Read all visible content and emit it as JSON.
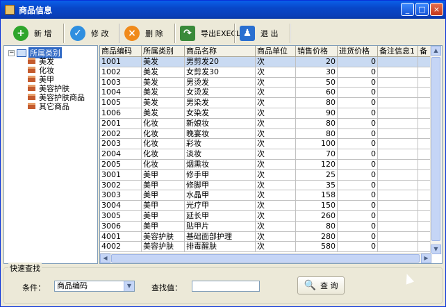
{
  "window": {
    "title": "商品信息",
    "min": "_",
    "max": "□",
    "close": "×"
  },
  "toolbar": [
    {
      "label": "新 增",
      "icon": "add-icon",
      "color": "#2fa52b",
      "glyph": "+"
    },
    {
      "label": "修 改",
      "icon": "edit-check-icon",
      "color": "#2f8fe0",
      "glyph": "✓"
    },
    {
      "label": "删 除",
      "icon": "delete-icon",
      "color": "#f08a1a",
      "glyph": "×"
    },
    {
      "label": "导出EXECL",
      "icon": "export-arrow-icon",
      "color": "#3a8a3a",
      "glyph": "↷"
    },
    {
      "label": "退 出",
      "icon": "exit-person-icon",
      "color": "#2a6fd0",
      "glyph": "♟"
    }
  ],
  "tree": {
    "root": "所属类别",
    "collapse": "−",
    "items": [
      "美发",
      "化妆",
      "美甲",
      "美容护肤",
      "美容护肤商品",
      "其它商品"
    ]
  },
  "table": {
    "columns": [
      "商品编码",
      "所属类别",
      "商品名称",
      "商品单位",
      "销售价格",
      "进货价格",
      "备注信息1",
      "备"
    ],
    "rows": [
      [
        "1001",
        "美发",
        "男剪发20",
        "次",
        "20",
        "0",
        "",
        ""
      ],
      [
        "1002",
        "美发",
        "女剪发30",
        "次",
        "30",
        "0",
        "",
        ""
      ],
      [
        "1003",
        "美发",
        "男烫发",
        "次",
        "50",
        "0",
        "",
        ""
      ],
      [
        "1004",
        "美发",
        "女烫发",
        "次",
        "60",
        "0",
        "",
        ""
      ],
      [
        "1005",
        "美发",
        "男染发",
        "次",
        "80",
        "0",
        "",
        ""
      ],
      [
        "1006",
        "美发",
        "女染发",
        "次",
        "90",
        "0",
        "",
        ""
      ],
      [
        "2001",
        "化妆",
        "新娘妆",
        "次",
        "80",
        "0",
        "",
        ""
      ],
      [
        "2002",
        "化妆",
        "晚宴妆",
        "次",
        "80",
        "0",
        "",
        ""
      ],
      [
        "2003",
        "化妆",
        "彩妆",
        "次",
        "100",
        "0",
        "",
        ""
      ],
      [
        "2004",
        "化妆",
        "淡妆",
        "次",
        "70",
        "0",
        "",
        ""
      ],
      [
        "2005",
        "化妆",
        "烟熏妆",
        "次",
        "120",
        "0",
        "",
        ""
      ],
      [
        "3001",
        "美甲",
        "修手甲",
        "次",
        "25",
        "0",
        "",
        ""
      ],
      [
        "3002",
        "美甲",
        "修脚甲",
        "次",
        "35",
        "0",
        "",
        ""
      ],
      [
        "3003",
        "美甲",
        "水晶甲",
        "次",
        "158",
        "0",
        "",
        ""
      ],
      [
        "3004",
        "美甲",
        "光疗甲",
        "次",
        "150",
        "0",
        "",
        ""
      ],
      [
        "3005",
        "美甲",
        "延长甲",
        "次",
        "260",
        "0",
        "",
        ""
      ],
      [
        "3006",
        "美甲",
        "贴甲片",
        "次",
        "80",
        "0",
        "",
        ""
      ],
      [
        "4001",
        "美容护肤",
        "基础面部护理",
        "次",
        "280",
        "0",
        "",
        ""
      ],
      [
        "4002",
        "美容护肤",
        "排毒醒肤",
        "次",
        "580",
        "0",
        "",
        ""
      ]
    ]
  },
  "search": {
    "group_label": "快速查找",
    "condition_label": "条件：",
    "condition_value": "商品编码",
    "find_label": "查找值：",
    "find_value": "",
    "button_label": "查 询"
  }
}
